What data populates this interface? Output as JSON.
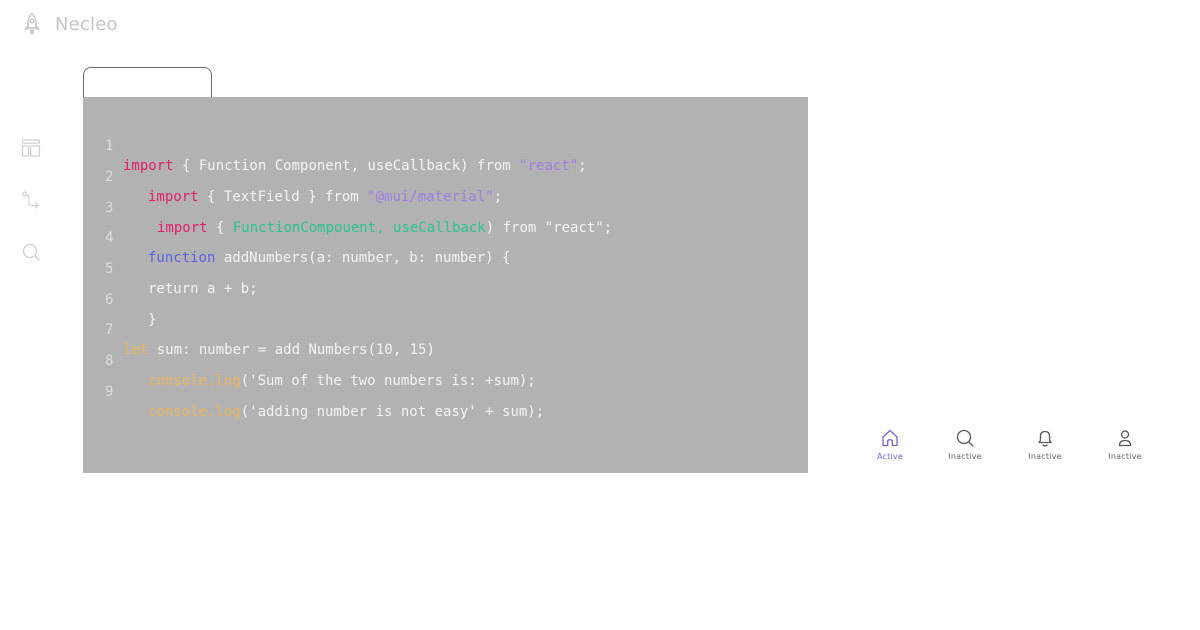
{
  "app": {
    "title": "Necleo"
  },
  "sidebar": {
    "icons": [
      "layout-icon",
      "route-icon",
      "search-icon"
    ]
  },
  "editor": {
    "tab_label": "",
    "lines": [
      {
        "no": "1",
        "tokens": [
          {
            "t": "import",
            "c": "kw"
          },
          {
            "t": " { Function Component, useCallback) from ",
            "c": ""
          },
          {
            "t": "\"react\"",
            "c": "str"
          },
          {
            "t": ";",
            "c": ""
          }
        ]
      },
      {
        "no": "2",
        "tokens": [
          {
            "t": "import",
            "c": "kw"
          },
          {
            "t": " { TextField } from ",
            "c": ""
          },
          {
            "t": "\"@mui/material\"",
            "c": "str"
          },
          {
            "t": ";",
            "c": ""
          }
        ]
      },
      {
        "no": "3",
        "tokens": [
          {
            "t": "import",
            "c": "kw"
          },
          {
            "t": " { ",
            "c": ""
          },
          {
            "t": "FunctionCompouent, useCallback",
            "c": "grn"
          },
          {
            "t": ") from \"react\";",
            "c": ""
          }
        ]
      },
      {
        "no": "4",
        "tokens": [
          {
            "t": "function",
            "c": "fn"
          },
          {
            "t": " addNumbers(a: number, b: number) {",
            "c": ""
          }
        ]
      },
      {
        "no": "5",
        "tokens": [
          {
            "t": "return a + b;",
            "c": ""
          }
        ]
      },
      {
        "no": "6",
        "tokens": [
          {
            "t": "}",
            "c": ""
          }
        ]
      },
      {
        "no": "7",
        "tokens": [
          {
            "t": "let",
            "c": "yel"
          },
          {
            "t": " sum: number = add Numbers(10, 15)",
            "c": ""
          }
        ]
      },
      {
        "no": "8",
        "tokens": [
          {
            "t": "console.log",
            "c": "yel"
          },
          {
            "t": "('Sum of the two numbers is: +sum);",
            "c": ""
          }
        ]
      },
      {
        "no": "9",
        "tokens": [
          {
            "t": "console.log",
            "c": "yel"
          },
          {
            "t": "('adding number is not easy' + sum);",
            "c": ""
          }
        ]
      }
    ]
  },
  "bottom_nav": {
    "items": [
      {
        "label": "Active",
        "icon": "home-icon",
        "active": true
      },
      {
        "label": "Inactive",
        "icon": "search-icon",
        "active": false
      },
      {
        "label": "Inactive",
        "icon": "bell-icon",
        "active": false
      },
      {
        "label": "Inactive",
        "icon": "user-icon",
        "active": false
      }
    ]
  },
  "colors": {
    "active": "#6b66df",
    "keyword": "#e41e68",
    "string": "#a07ee6",
    "function": "#5b63e6",
    "highlight_green": "#28c690",
    "highlight_yellow": "#e9b45a",
    "editor_bg": "#b1b1b1"
  }
}
